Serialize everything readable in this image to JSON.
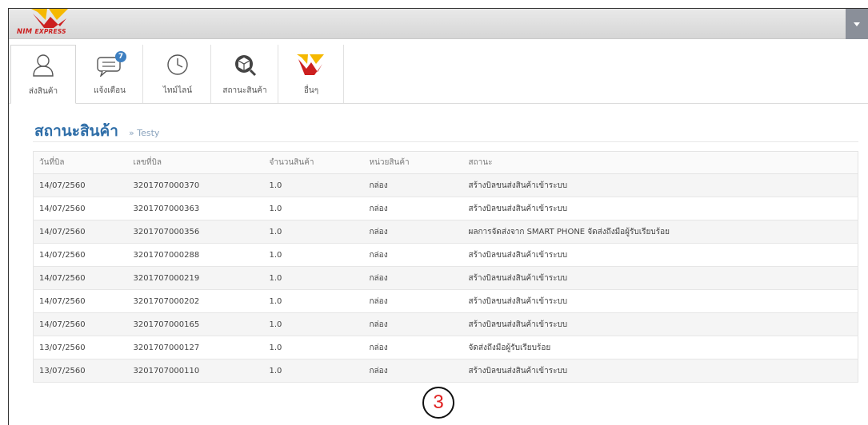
{
  "app": {
    "logo_text_main": "NIM",
    "logo_text_sub": "EXPRESS",
    "accent_color": "#2f6ea8",
    "brand_red": "#cc1f1f",
    "brand_yellow": "#f5b800"
  },
  "nav": {
    "items": [
      {
        "label": "ส่งสินค้า",
        "icon": "user-icon",
        "active": true
      },
      {
        "label": "แจ้งเตือน",
        "icon": "chat-bubble-icon",
        "badge": "7"
      },
      {
        "label": "ไทม์ไลน์",
        "icon": "clock-icon"
      },
      {
        "label": "สถานะสินค้า",
        "icon": "package-search-icon"
      },
      {
        "label": "อื่นๆ",
        "icon": "nim-logo-icon"
      }
    ]
  },
  "page": {
    "title": "สถานะสินค้า",
    "breadcrumb": "» Testy"
  },
  "table": {
    "headers": [
      "วันที่บิล",
      "เลขที่บิล",
      "จำนวนสินค้า",
      "หน่วยสินค้า",
      "สถานะ"
    ],
    "rows": [
      [
        "14/07/2560",
        "3201707000370",
        "1.0",
        "กล่อง",
        "สร้างบิลขนส่งสินค้าเข้าระบบ"
      ],
      [
        "14/07/2560",
        "3201707000363",
        "1.0",
        "กล่อง",
        "สร้างบิลขนส่งสินค้าเข้าระบบ"
      ],
      [
        "14/07/2560",
        "3201707000356",
        "1.0",
        "กล่อง",
        "ผลการจัดส่งจาก SMART PHONE จัดส่งถึงมือผู้รับเรียบร้อย"
      ],
      [
        "14/07/2560",
        "3201707000288",
        "1.0",
        "กล่อง",
        "สร้างบิลขนส่งสินค้าเข้าระบบ"
      ],
      [
        "14/07/2560",
        "3201707000219",
        "1.0",
        "กล่อง",
        "สร้างบิลขนส่งสินค้าเข้าระบบ"
      ],
      [
        "14/07/2560",
        "3201707000202",
        "1.0",
        "กล่อง",
        "สร้างบิลขนส่งสินค้าเข้าระบบ"
      ],
      [
        "14/07/2560",
        "3201707000165",
        "1.0",
        "กล่อง",
        "สร้างบิลขนส่งสินค้าเข้าระบบ"
      ],
      [
        "13/07/2560",
        "3201707000127",
        "1.0",
        "กล่อง",
        "จัดส่งถึงมือผู้รับเรียบร้อย"
      ],
      [
        "13/07/2560",
        "3201707000110",
        "1.0",
        "กล่อง",
        "สร้างบิลขนส่งสินค้าเข้าระบบ"
      ]
    ]
  },
  "annotation": {
    "step_number": "3"
  }
}
